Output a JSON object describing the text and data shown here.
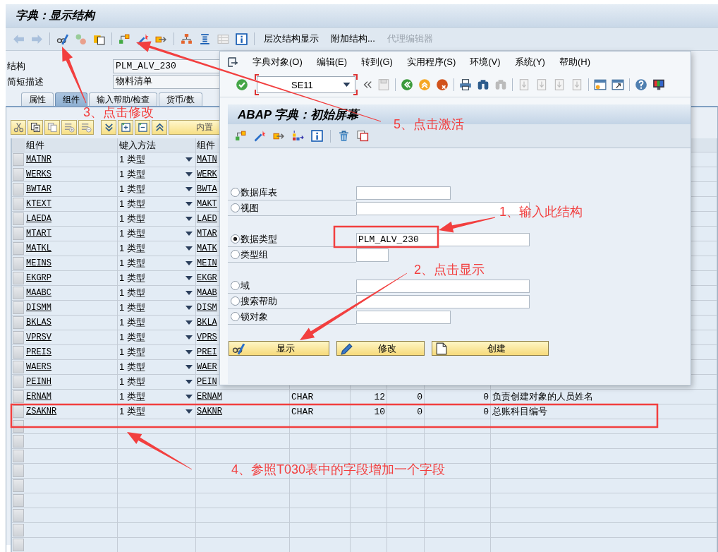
{
  "window": {
    "title": "字典：显示结构"
  },
  "toolbar": {
    "buttons": [
      {
        "label": "层次结构显示",
        "disabled": false
      },
      {
        "label": "附加结构...",
        "disabled": false
      },
      {
        "label": "代理编辑器",
        "disabled": true
      }
    ]
  },
  "header_fields": [
    {
      "label": "结构",
      "value": "PLM_ALV_230"
    },
    {
      "label": "简短描述",
      "value": "物料清单"
    }
  ],
  "tabs": [
    {
      "label": "属性",
      "selected": false
    },
    {
      "label": "组件",
      "selected": true
    },
    {
      "label": "输入帮助/检查",
      "selected": false
    },
    {
      "label": "货币/数",
      "selected": false
    }
  ],
  "table_toolbar": {
    "button_label": "内置"
  },
  "table": {
    "columns": [
      "组件",
      "键入方法",
      "组件"
    ],
    "rows": [
      [
        "MATNR",
        "1 类型",
        "MATN"
      ],
      [
        "WERKS",
        "1 类型",
        "WERK"
      ],
      [
        "BWTAR",
        "1 类型",
        "BWTA"
      ],
      [
        "KTEXT",
        "1 类型",
        "MAKT"
      ],
      [
        "LAEDA",
        "1 类型",
        "LAED"
      ],
      [
        "MTART",
        "1 类型",
        "MTAR"
      ],
      [
        "MATKL",
        "1 类型",
        "MATK"
      ],
      [
        "MEINS",
        "1 类型",
        "MEIN"
      ],
      [
        "EKGRP",
        "1 类型",
        "EKGR"
      ],
      [
        "MAABC",
        "1 类型",
        "MAAB"
      ],
      [
        "DISMM",
        "1 类型",
        "DISM"
      ],
      [
        "BKLAS",
        "1 类型",
        "BKLA"
      ],
      [
        "VPRSV",
        "1 类型",
        "VPRS"
      ],
      [
        "PREIS",
        "1 类型",
        "PREI"
      ],
      [
        "WAERS",
        "1 类型",
        "WAER"
      ],
      [
        "PEINH",
        "1 类型",
        "PEIN"
      ],
      [
        "ERNAM",
        "1 类型",
        "ERNAM",
        "CHAR",
        "12",
        "0",
        "0",
        "负责创建对象的人员姓名"
      ],
      [
        "ZSAKNR",
        "1 类型",
        "SAKNR",
        "CHAR",
        "10",
        "0",
        "0",
        "总账科目编号"
      ]
    ]
  },
  "dialog": {
    "menu": [
      "字典对象(O)",
      "编辑(E)",
      "转到(G)",
      "实用程序(S)",
      "环境(V)",
      "系统(Y)",
      "帮助(H)"
    ],
    "command_field": {
      "value": "SE11"
    },
    "title": "ABAP 字典：初始屏幕",
    "options": [
      {
        "label": "数据库表",
        "selected": false
      },
      {
        "label": "视图",
        "selected": false
      },
      {
        "label": "数据类型",
        "selected": true,
        "value": "PLM_ALV_230"
      },
      {
        "label": "类型组",
        "selected": false
      },
      {
        "label": "域",
        "selected": false
      },
      {
        "label": "搜索帮助",
        "selected": false
      },
      {
        "label": "锁对象",
        "selected": false
      }
    ],
    "buttons": [
      "显示",
      "修改",
      "创建"
    ]
  },
  "annotations": [
    {
      "text": "3、点击修改"
    },
    {
      "text": "5、点击激活"
    },
    {
      "text": "1、输入此结构"
    },
    {
      "text": "2、点击显示"
    },
    {
      "text": "4、参照T030表中的字段增加一个字段"
    }
  ]
}
